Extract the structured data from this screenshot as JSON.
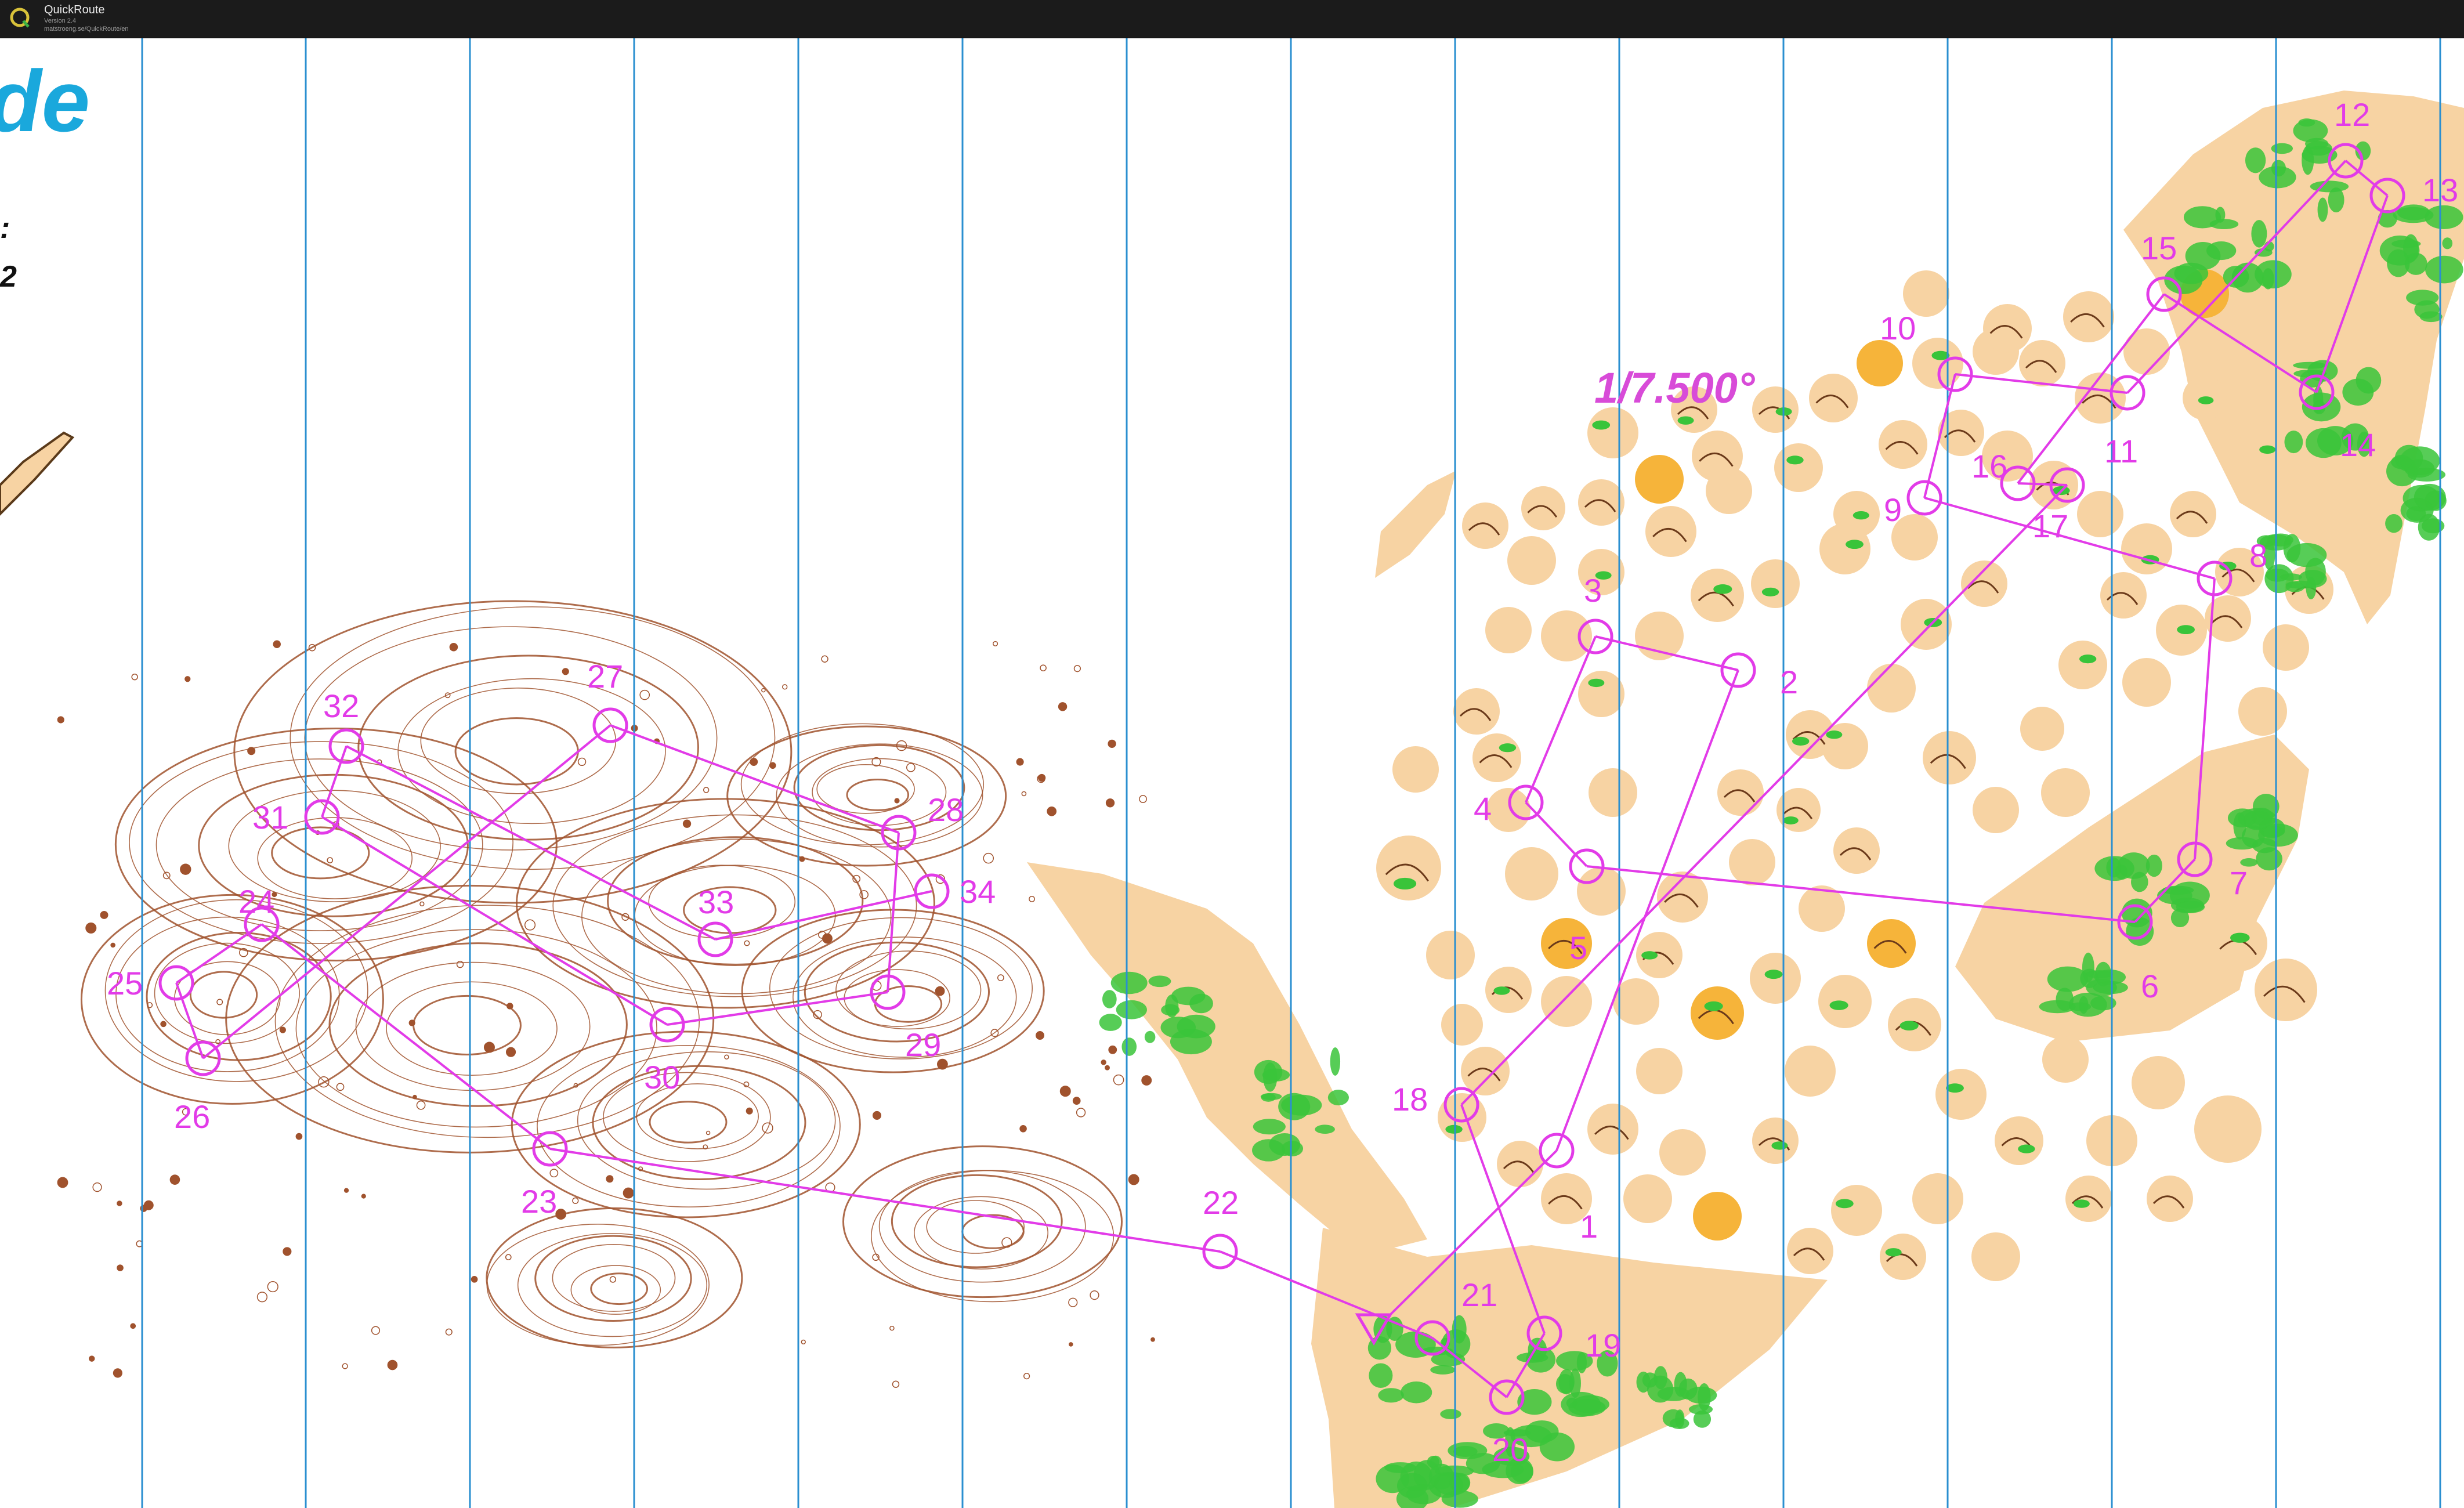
{
  "app": {
    "title": "QuickRoute",
    "version": "Version 2.4",
    "url": "matstroeng.se/QuickRoute/en"
  },
  "map": {
    "event_title_fragment": "de",
    "side_text_1": ":",
    "side_text_2": "2",
    "scale_label": "1/7.500°",
    "colors": {
      "background": "#ffffff",
      "grid_line": "#2a8fd0",
      "course": "#e23be8",
      "terrain_fill": "#f7d3a3",
      "vegetation": "#39c43a",
      "open_yellow": "#f6b43a",
      "contour": "#a0522d",
      "title_blue": "#1aa8dc"
    },
    "controls": [
      {
        "id": "1",
        "label": "1"
      },
      {
        "id": "2",
        "label": "2"
      },
      {
        "id": "3",
        "label": "3"
      },
      {
        "id": "4",
        "label": "4"
      },
      {
        "id": "5",
        "label": "5"
      },
      {
        "id": "6",
        "label": "6"
      },
      {
        "id": "7",
        "label": "7"
      },
      {
        "id": "8",
        "label": "8"
      },
      {
        "id": "9",
        "label": "9"
      },
      {
        "id": "10",
        "label": "10"
      },
      {
        "id": "11",
        "label": "11"
      },
      {
        "id": "12",
        "label": "12"
      },
      {
        "id": "13",
        "label": "13"
      },
      {
        "id": "14",
        "label": "14"
      },
      {
        "id": "15",
        "label": "15"
      },
      {
        "id": "16",
        "label": "16"
      },
      {
        "id": "17",
        "label": "17"
      },
      {
        "id": "18",
        "label": "18"
      },
      {
        "id": "19",
        "label": "19"
      },
      {
        "id": "20",
        "label": "20"
      },
      {
        "id": "21",
        "label": "21"
      },
      {
        "id": "22",
        "label": "22"
      },
      {
        "id": "23",
        "label": "23"
      },
      {
        "id": "24",
        "label": "24"
      },
      {
        "id": "25",
        "label": "25"
      },
      {
        "id": "26",
        "label": "26"
      },
      {
        "id": "27",
        "label": "27"
      },
      {
        "id": "28",
        "label": "28"
      },
      {
        "id": "29",
        "label": "29"
      },
      {
        "id": "30",
        "label": "30"
      },
      {
        "id": "31",
        "label": "31"
      },
      {
        "id": "32",
        "label": "32"
      },
      {
        "id": "33",
        "label": "33"
      },
      {
        "id": "34",
        "label": "34"
      }
    ]
  }
}
